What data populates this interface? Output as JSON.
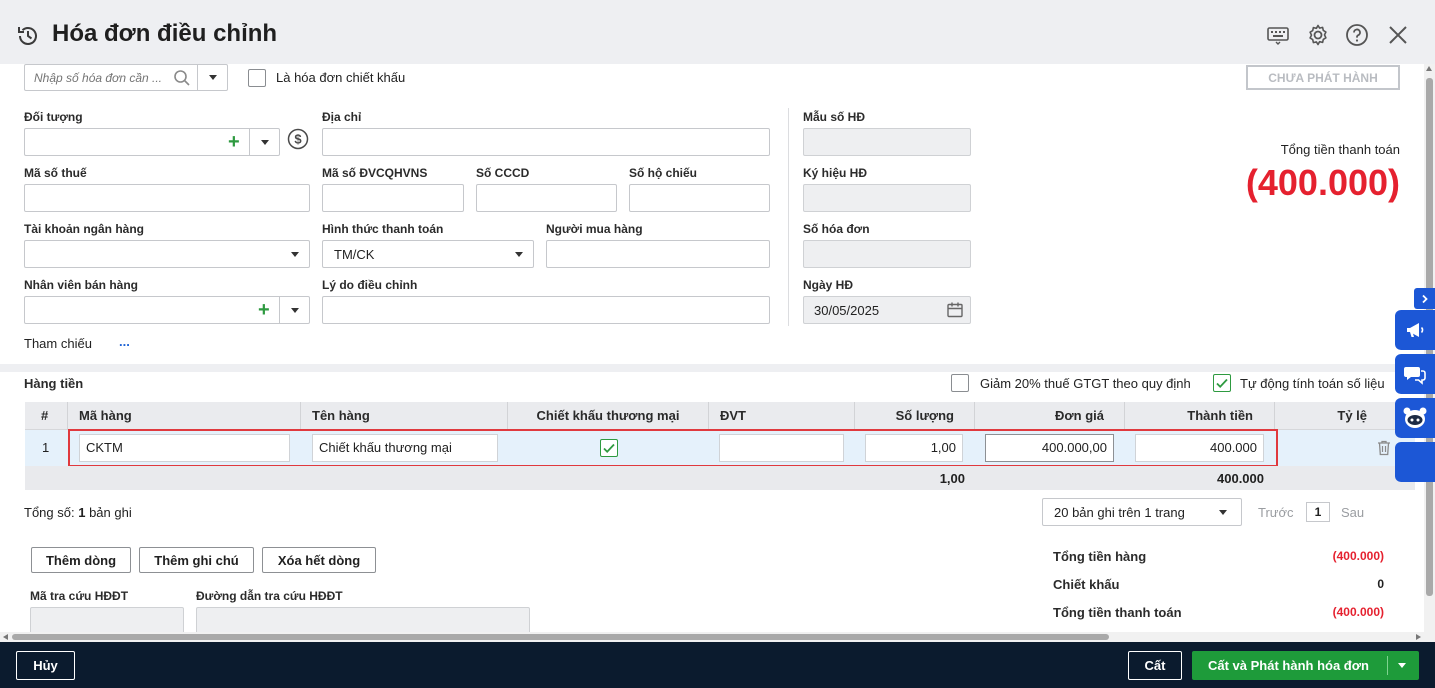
{
  "window": {
    "title": "Hóa đơn điều chỉnh",
    "status_button": "CHƯA PHÁT HÀNH"
  },
  "search": {
    "placeholder": "Nhập số hóa đơn cần ..."
  },
  "discount_invoice_label": "Là hóa đơn chiết khấu",
  "form": {
    "doi_tuong_label": "Đối tượng",
    "dia_chi_label": "Địa chỉ",
    "ma_so_thue_label": "Mã số thuế",
    "ma_so_dvcqhvns_label": "Mã số ĐVCQHVNS",
    "so_cccd_label": "Số CCCD",
    "so_ho_chieu_label": "Số hộ chiếu",
    "tai_khoan_label": "Tài khoản ngân hàng",
    "hinh_thuc_label": "Hình thức thanh toán",
    "hinh_thuc_value": "TM/CK",
    "nguoi_mua_label": "Người mua hàng",
    "nhan_vien_label": "Nhân viên bán hàng",
    "ly_do_label": "Lý do điều chỉnh",
    "tham_chieu_label": "Tham chiếu",
    "tham_chieu_more": "..."
  },
  "invoice_info": {
    "mau_so_label": "Mẫu số HĐ",
    "ky_hieu_label": "Ký hiệu HĐ",
    "so_hoa_don_label": "Số hóa đơn",
    "ngay_label": "Ngày HĐ",
    "ngay_value": "30/05/2025"
  },
  "total_payment": {
    "label": "Tổng tiền thanh toán",
    "value": "(400.000)"
  },
  "goods": {
    "section_label": "Hàng tiền",
    "reduce_vat_label": "Giảm 20% thuế GTGT theo quy định",
    "auto_calc_label": "Tự động tính toán số liệu",
    "columns": [
      "#",
      "Mã hàng",
      "Tên hàng",
      "Chiết khấu thương mại",
      "ĐVT",
      "Số lượng",
      "Đơn giá",
      "Thành tiền",
      "Tỷ lệ"
    ],
    "rows": [
      {
        "index": "1",
        "ma_hang": "CKTM",
        "ten_hang": "Chiết khấu thương mại",
        "dvt": "",
        "so_luong": "1,00",
        "don_gia": "400.000,00",
        "thanh_tien": "400.000"
      }
    ],
    "sum_so_luong": "1,00",
    "sum_thanh_tien": "400.000"
  },
  "pagination": {
    "total_prefix": "Tổng số:",
    "total_count": "1",
    "total_suffix": "bản ghi",
    "page_size": "20 bản ghi trên 1 trang",
    "prev": "Trước",
    "page": "1",
    "next": "Sau"
  },
  "actions": {
    "add_row": "Thêm dòng",
    "add_note": "Thêm ghi chú",
    "delete_all": "Xóa hết dòng"
  },
  "lookup": {
    "code_label": "Mã tra cứu HĐĐT",
    "link_label": "Đường dẫn tra cứu HĐĐT"
  },
  "summary": {
    "tong_tien_hang_label": "Tổng tiền hàng",
    "tong_tien_hang_value": "(400.000)",
    "chiet_khau_label": "Chiết khấu",
    "chiet_khau_value": "0",
    "tong_thanh_toan_label": "Tổng tiền thanh toán",
    "tong_thanh_toan_value": "(400.000)"
  },
  "footer": {
    "cancel": "Hủy",
    "save": "Cất",
    "save_publish": "Cất và Phát hành hóa đơn"
  },
  "colors": {
    "accent_green": "#1e9b3a",
    "negative_red": "#e5212f",
    "footer_bg": "#0b1b2e",
    "side_blue": "#1c57d6",
    "row_highlight_border": "#e0393e"
  }
}
